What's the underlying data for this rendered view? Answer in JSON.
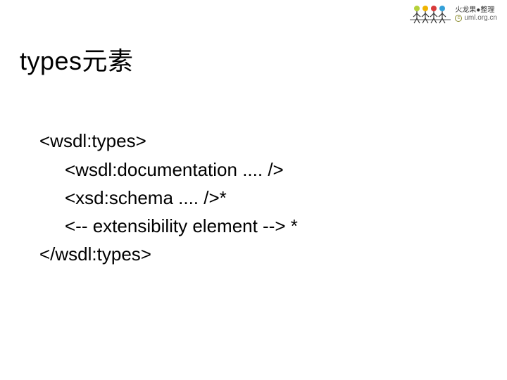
{
  "watermark": {
    "brand": "火龙果●整理",
    "site": "uml.org.cn",
    "figure_colors": [
      "#b5d13a",
      "#f0b400",
      "#d83a3a",
      "#34a0d8"
    ]
  },
  "title": "types元素",
  "code": {
    "line1": "<wsdl:types>",
    "line2": "<wsdl:documentation .... />",
    "line3": "<xsd:schema .... />*",
    "line4": "<-- extensibility element --> *",
    "line5": "</wsdl:types>"
  }
}
